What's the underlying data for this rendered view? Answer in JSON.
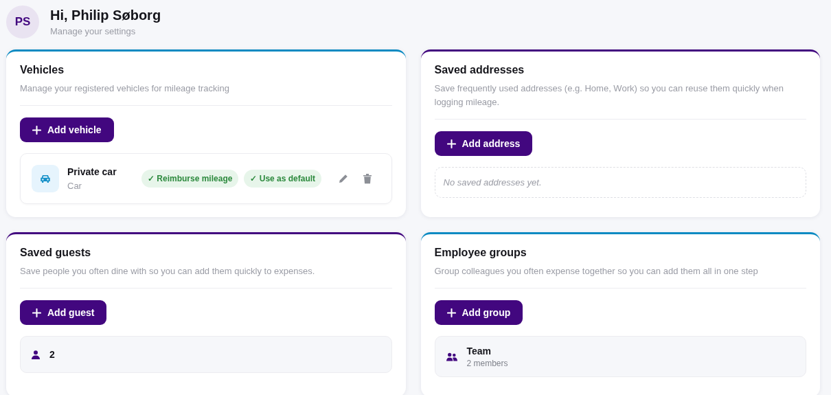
{
  "header": {
    "initials": "PS",
    "greeting": "Hi, Philip Søborg",
    "subtitle": "Manage your settings"
  },
  "cards": [
    {
      "title": "Vehicles",
      "description": "Manage your registered vehicles for mileage tracking",
      "color": "#0a8ac2",
      "button": "Add vehicle",
      "items": [
        {
          "kind": "vehicle",
          "name": "Private car",
          "type": "Car",
          "badges": [
            "✓ Reimburse mileage",
            "✓ Use as default"
          ]
        }
      ]
    },
    {
      "title": "Saved addresses",
      "description": "Save frequently used addresses (e.g. Home, Work) so you can reuse them quickly when logging mileage.",
      "color": "#42077f",
      "button": "Add address",
      "items": [
        {
          "kind": "empty",
          "text": "No saved addresses yet."
        }
      ]
    },
    {
      "title": "Saved guests",
      "description": "Save people you often dine with so you can add them quickly to expenses.",
      "color": "#42077f",
      "button": "Add guest",
      "items": [
        {
          "kind": "guest",
          "name": "2"
        }
      ]
    },
    {
      "title": "Employee groups",
      "description": "Group colleagues you often expense together so you can add them all in one step",
      "color": "#0a8ac2",
      "button": "Add group",
      "items": [
        {
          "kind": "group",
          "name": "Team",
          "members": "2 members"
        }
      ]
    }
  ]
}
